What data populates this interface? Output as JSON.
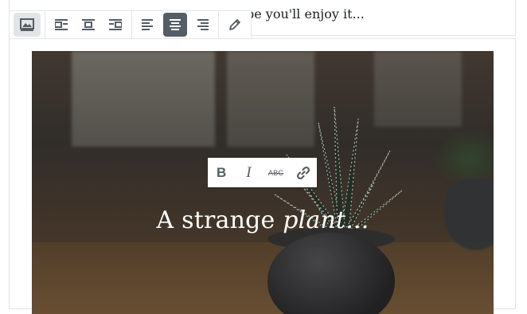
{
  "paragraph": {
    "text": "pe you'll enjoy it..."
  },
  "cover": {
    "caption_plain": "A strange ",
    "caption_italic": "plant..."
  },
  "block_toolbar": {
    "buttons": [
      "change-block-type",
      "align-left-wrap",
      "align-center-block",
      "align-right-wrap",
      "align-left",
      "align-center",
      "align-right",
      "edit"
    ],
    "active": "align-center"
  },
  "format_toolbar": {
    "bold_label": "B",
    "italic_label": "I",
    "strike_label": "ABC",
    "link_icon": "link-icon"
  },
  "colors": {
    "toolbar_icon": "#555d66",
    "active_bg": "#555d66",
    "border": "#e2e4e7"
  }
}
